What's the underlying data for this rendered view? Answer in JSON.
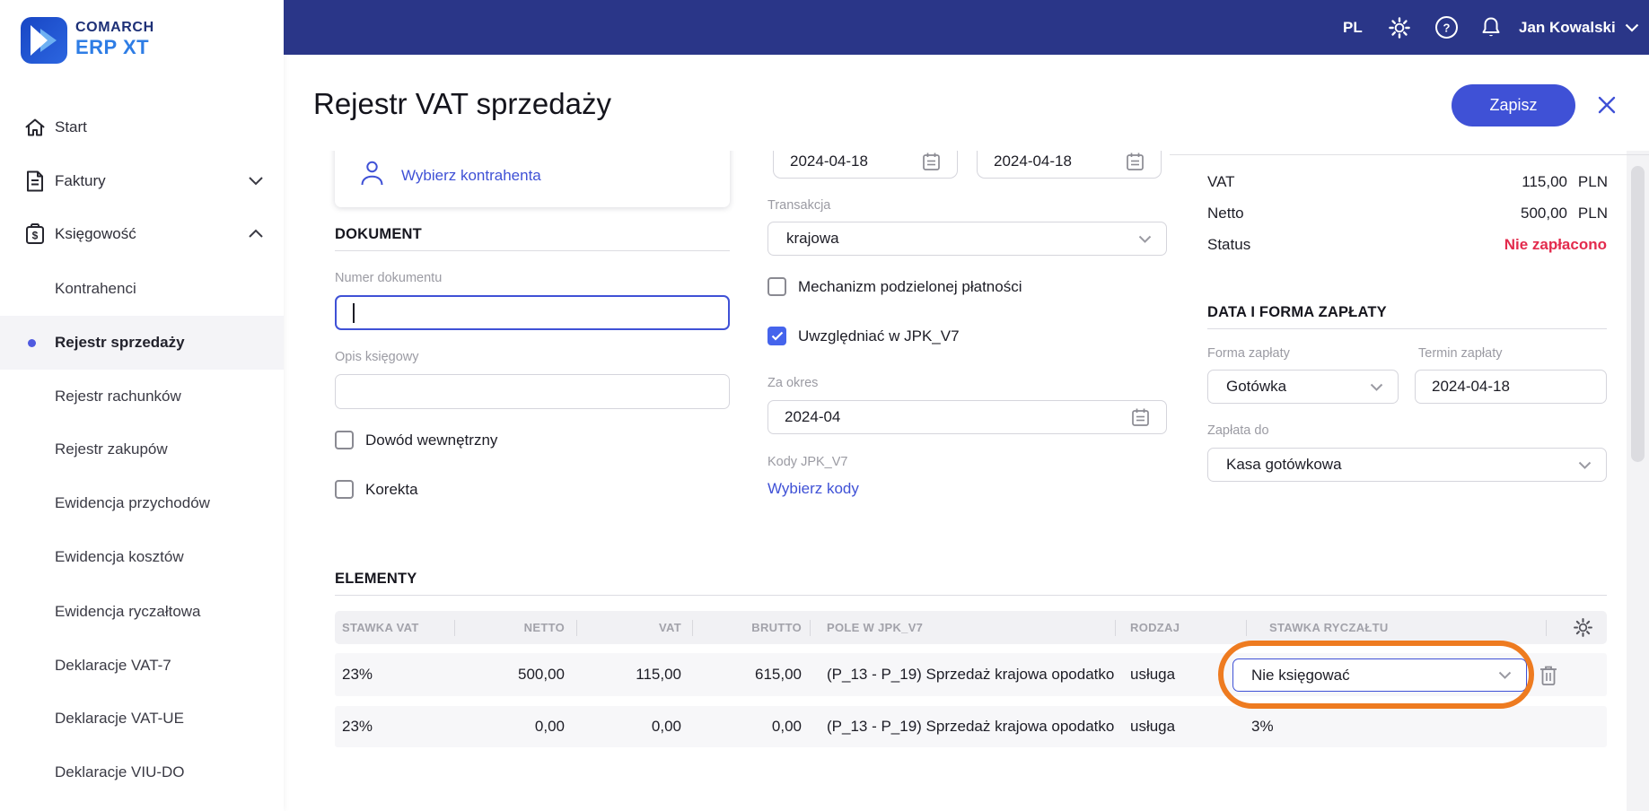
{
  "brand": {
    "name_top": "COMARCH",
    "name_bottom": "ERP XT"
  },
  "topbar": {
    "language": "PL",
    "user_name": "Jan Kowalski"
  },
  "sidebar": {
    "items": [
      {
        "label": "Start",
        "icon": "home-icon"
      },
      {
        "label": "Faktury",
        "icon": "invoice-icon",
        "chevron": "down"
      },
      {
        "label": "Księgowość",
        "icon": "accounting-icon",
        "chevron": "up"
      }
    ],
    "subitems": [
      {
        "label": "Kontrahenci"
      },
      {
        "label": "Rejestr sprzedaży",
        "active": true
      },
      {
        "label": "Rejestr rachunków"
      },
      {
        "label": "Rejestr zakupów"
      },
      {
        "label": "Ewidencja przychodów"
      },
      {
        "label": "Ewidencja kosztów"
      },
      {
        "label": "Ewidencja ryczałtowa"
      },
      {
        "label": "Deklaracje VAT-7"
      },
      {
        "label": "Deklaracje VAT-UE"
      },
      {
        "label": "Deklaracje VIU-DO"
      }
    ]
  },
  "header": {
    "title": "Rejestr VAT sprzedaży",
    "save_button": "Zapisz"
  },
  "form": {
    "contractor_link": "Wybierz kontrahenta",
    "date_issue": "2024-04-18",
    "date_sale": "2024-04-18",
    "document_section": "DOKUMENT",
    "document_number_label": "Numer dokumentu",
    "document_number_value": "",
    "description_label": "Opis księgowy",
    "description_value": "",
    "internal_doc_checkbox": "Dowód wewnętrzny",
    "correction_checkbox": "Korekta",
    "transaction_label": "Transakcja",
    "transaction_value": "krajowa",
    "split_payment_checkbox": "Mechanizm podzielonej płatności",
    "jpk_checkbox": "Uwzględniać w JPK_V7",
    "period_label": "Za okres",
    "period_value": "2024-04",
    "jpk_codes_label": "Kody JPK_V7",
    "jpk_codes_link": "Wybierz kody"
  },
  "summary": {
    "vat_label": "VAT",
    "vat_value": "115,00",
    "vat_currency": "PLN",
    "netto_label": "Netto",
    "netto_value": "500,00",
    "netto_currency": "PLN",
    "status_label": "Status",
    "status_value": "Nie zapłacono"
  },
  "payment": {
    "section": "DATA I FORMA ZAPŁATY",
    "method_label": "Forma zapłaty",
    "method_value": "Gotówka",
    "due_label": "Termin zapłaty",
    "due_value": "2024-04-18",
    "pay_to_label": "Zapłata do",
    "pay_to_value": "Kasa gotówkowa"
  },
  "elements": {
    "section": "ELEMENTY",
    "columns": [
      "STAWKA VAT",
      "NETTO",
      "VAT",
      "BRUTTO",
      "POLE W JPK_V7",
      "RODZAJ",
      "STAWKA RYCZAŁTU"
    ],
    "rows": [
      {
        "stawka_vat": "23%",
        "netto": "500,00",
        "vat": "115,00",
        "brutto": "615,00",
        "pole_jpk": "(P_13 - P_19) Sprzedaż krajowa opodatko",
        "rodzaj": "usługa",
        "stawka_ryczaltu": "Nie księgować"
      },
      {
        "stawka_vat": "23%",
        "netto": "0,00",
        "vat": "0,00",
        "brutto": "0,00",
        "pole_jpk": "(P_13 - P_19) Sprzedaż krajowa opodatko",
        "rodzaj": "usługa",
        "stawka_ryczaltu": "3%"
      }
    ]
  },
  "colors": {
    "accent_blue": "#3f51d6",
    "topbar_navy": "#2a3688",
    "status_red": "#e32b4d",
    "annotation_orange": "#ee7b20",
    "checkbox_checked": "#4564ec",
    "brand_blue": "#2e7de5"
  }
}
